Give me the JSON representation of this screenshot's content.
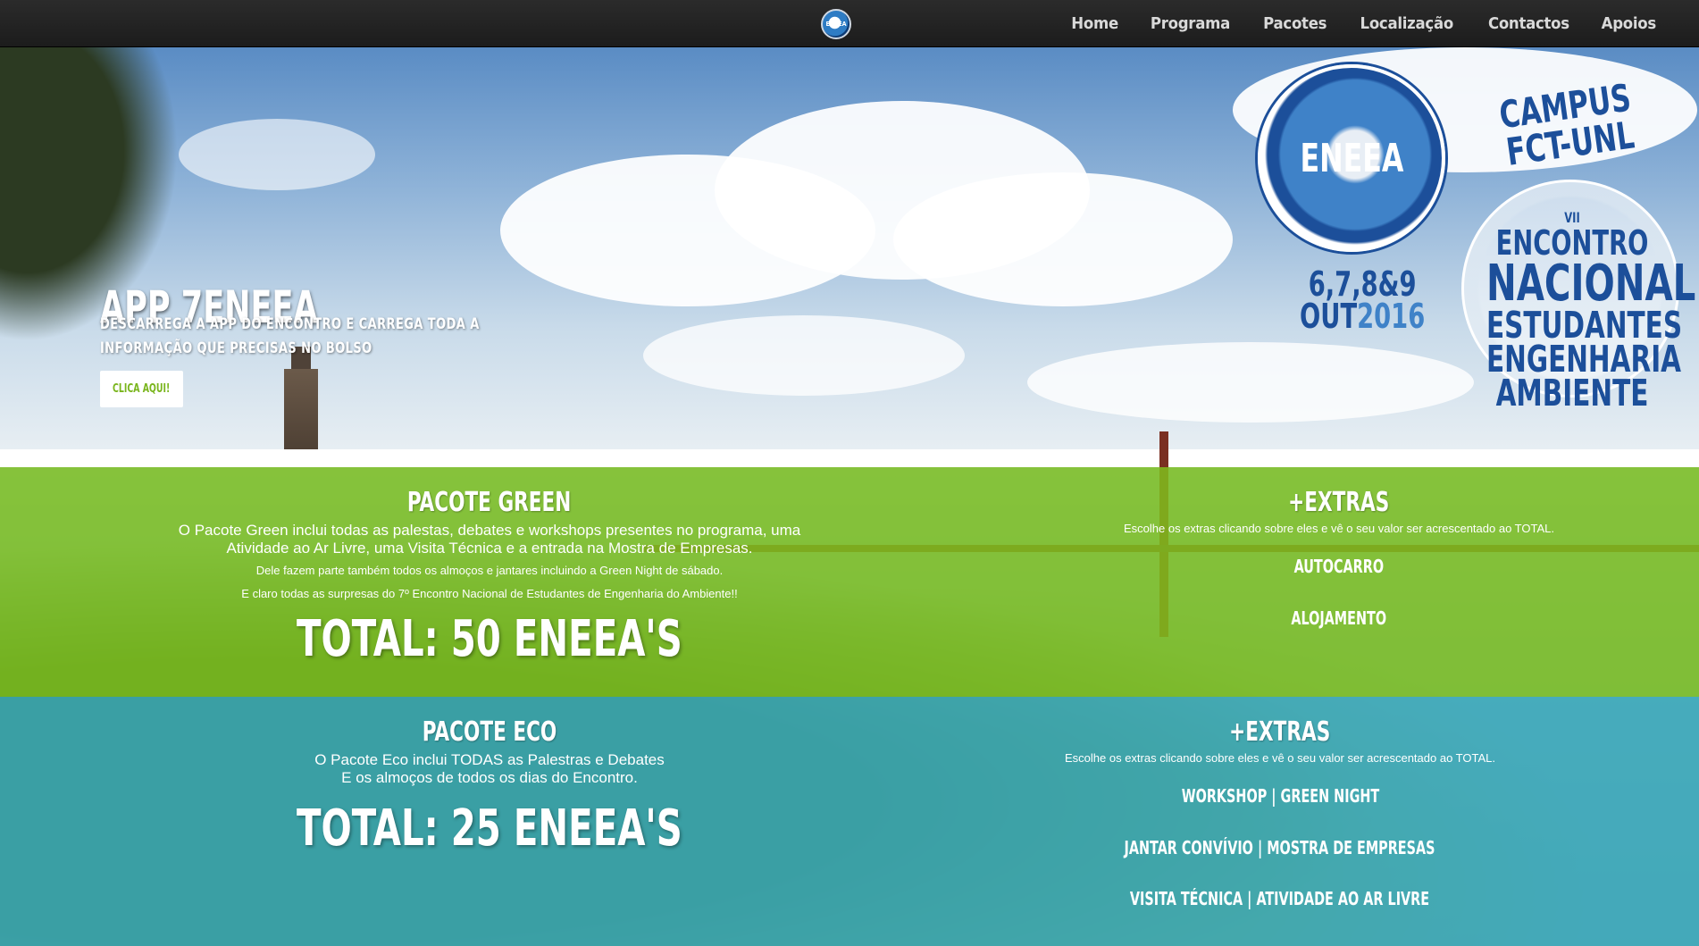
{
  "navbar": {
    "logo_text": "ENEEA",
    "links": [
      "Home",
      "Programa",
      "Pacotes",
      "Localização",
      "Contactos",
      "Apoios"
    ]
  },
  "hero": {
    "title": "APP 7ENEEA",
    "subtitle": "Descarrega a app do encontro e carrega toda a informação que precisas no bolso",
    "button_label": "CLICA AQUI!",
    "logo_text": "ENEEA",
    "dates_days": "6,7,8&9",
    "dates_month": "OUT",
    "dates_year": "2016",
    "campus_line1": "CAMPUS",
    "campus_line2": "FCT-UNL",
    "seal_line1": "VII",
    "seal_line2": "ENCONTRO",
    "seal_line3": "NACIONAL",
    "seal_line4": "ESTUDANTES",
    "seal_line5": "ENGENHARIA",
    "seal_line6": "AMBIENTE"
  },
  "packages": {
    "green": {
      "title": "PACOTE GREEN",
      "description": "O Pacote Green inclui todas as palestas, debates e workshops presentes no programa, uma Atividade ao Ar Livre, uma Visita Técnica e a entrada na Mostra de Empresas.",
      "note1": "Dele fazem parte também todos os almoços e jantares incluindo a Green Night de sábado.",
      "note2": "E claro todas as surpresas do 7º Encontro Nacional de Estudantes de Engenharia do Ambiente!!",
      "total": "TOTAL: 50 ENEEA'S",
      "extras_title": "+EXTRAS",
      "extras_desc": "Escolhe os extras clicando sobre eles e vê o seu valor ser acrescentado ao TOTAL.",
      "extras": [
        "AUTOCARRO",
        "ALOJAMENTO"
      ],
      "color": "#80c41c"
    },
    "eco": {
      "title": "PACOTE ECO",
      "description_line1": "O Pacote Eco inclui TODAS as Palestras e Debates",
      "description_line2": "E os almoços de todos os dias do Encontro.",
      "total": "TOTAL: 25 ENEEA'S",
      "extras_title": "+EXTRAS",
      "extras_desc": "Escolhe os extras clicando sobre eles e vê o seu valor ser acrescentado ao TOTAL.",
      "extras": [
        {
          "a": "WORKSHOP",
          "b": "GREEN NIGHT"
        },
        {
          "a": "JANTAR CONVÍVIO",
          "b": "MOSTRA DE EMPRESAS"
        },
        {
          "a": "VISITA TÉCNICA",
          "b": "ATIVIDADE AO AR LIVRE"
        }
      ],
      "separator": "|",
      "color": "#3aaebe"
    }
  },
  "colors": {
    "navbar_bg": "#222222",
    "brand_blue": "#1c4f9a",
    "button_text": "#79b51c"
  }
}
